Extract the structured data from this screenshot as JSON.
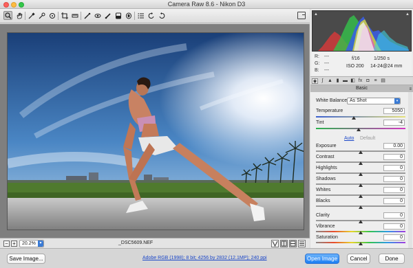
{
  "window": {
    "title": "Camera Raw 8.6  -  Nikon D3"
  },
  "toolbar": {
    "tools": [
      "zoom-icon",
      "hand-icon",
      "white-balance-icon",
      "color-sampler-icon",
      "targeted-adjustment-icon",
      "crop-icon",
      "straighten-icon",
      "spot-removal-icon",
      "red-eye-icon",
      "adjustment-brush-icon",
      "graduated-filter-icon",
      "radial-filter-icon",
      "list-icon",
      "rotate-left-icon",
      "rotate-right-icon"
    ]
  },
  "status": {
    "zoom": "20.2%",
    "filename": "_DSC5609.NEF"
  },
  "histogram": {
    "r": "R:",
    "g": "G:",
    "b": "B:",
    "r_value": "---",
    "g_value": "---",
    "b_value": "---",
    "aperture": "f/16",
    "shutter": "1/250 s",
    "iso": "ISO 200",
    "lens": "14-24@24 mm"
  },
  "panel": {
    "title": "Basic",
    "white_balance_label": "White Balance:",
    "white_balance_value": "As Shot",
    "auto": "Auto",
    "default": "Default",
    "temperature": {
      "label": "Temperature",
      "value": "5050",
      "position": 0.42
    },
    "tint": {
      "label": "Tint",
      "value": "-4",
      "position": 0.48
    },
    "exposure": {
      "label": "Exposure",
      "value": "0.00",
      "position": 0.5
    },
    "contrast": {
      "label": "Contrast",
      "value": "0",
      "position": 0.5
    },
    "highlights": {
      "label": "Highlights",
      "value": "0",
      "position": 0.5
    },
    "shadows": {
      "label": "Shadows",
      "value": "0",
      "position": 0.5
    },
    "whites": {
      "label": "Whites",
      "value": "0",
      "position": 0.5
    },
    "blacks": {
      "label": "Blacks",
      "value": "0",
      "position": 0.5
    },
    "clarity": {
      "label": "Clarity",
      "value": "0",
      "position": 0.5
    },
    "vibrance": {
      "label": "Vibrance",
      "value": "0",
      "position": 0.5
    },
    "saturation": {
      "label": "Saturation",
      "value": "0",
      "position": 0.5
    }
  },
  "footer": {
    "save_image": "Save Image...",
    "workflow_link": "Adobe RGB (1998); 8 bit; 4256 by 2832 (12.1MP); 240 ppi",
    "open_image": "Open Image",
    "cancel": "Cancel",
    "done": "Done"
  },
  "colors": {
    "accent": "#1b7ef3",
    "link": "#1a46c8"
  }
}
